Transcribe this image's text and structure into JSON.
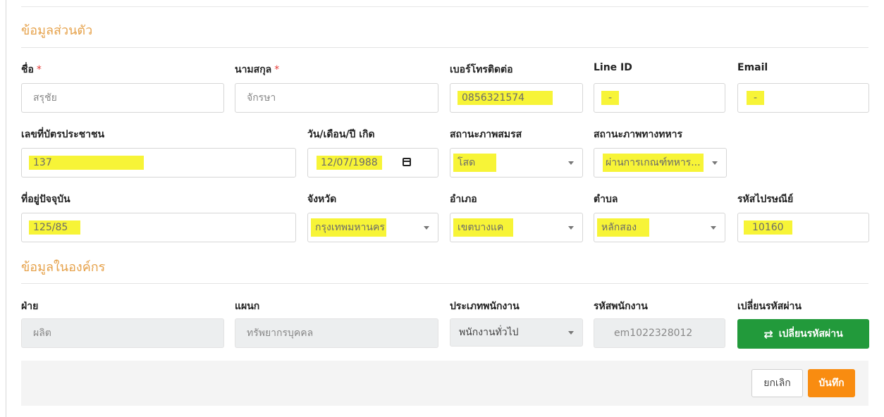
{
  "personal": {
    "title": "ข้อมูลส่วนตัว",
    "first_name": {
      "label": "ชื่อ",
      "required": "*",
      "placeholder": "สรุชัย"
    },
    "last_name": {
      "label": "นามสกุล",
      "required": "*",
      "placeholder": "จักรษา"
    },
    "phone": {
      "label": "เบอร์โทรติดต่อ",
      "value": "0856321574"
    },
    "line_id": {
      "label": "Line ID",
      "value": "-"
    },
    "email": {
      "label": "Email",
      "value": "-"
    },
    "id_card": {
      "label": "เลขที่บัตรประชาชน",
      "value": "137"
    },
    "birth_date": {
      "label": "วัน/เดือน/ปี เกิด",
      "value": "12/07/1988"
    },
    "marital_status": {
      "label": "สถานะภาพสมรส",
      "value": "โสด"
    },
    "military_status": {
      "label": "สถานะภาพทางทหาร",
      "value": "ผ่านการเกณฑ์ทหาร..."
    },
    "address": {
      "label": "ที่อยู่ปัจจุบัน",
      "value": "125/85"
    },
    "province": {
      "label": "จังหวัด",
      "value": "กรุงเทพมหานคร"
    },
    "district": {
      "label": "อำเภอ",
      "value": "เขตบางแค"
    },
    "subdistrict": {
      "label": "ตำบล",
      "value": "หลักสอง"
    },
    "postal_code": {
      "label": "รหัสไปรษณีย์",
      "value": "10160"
    }
  },
  "organization": {
    "title": "ข้อมูลในองค์กร",
    "department": {
      "label": "ฝ่าย",
      "value": "ผลิต"
    },
    "section": {
      "label": "แผนก",
      "value": "ทรัพยากรบุคคล"
    },
    "employee_type": {
      "label": "ประเภทพนักงาน",
      "value": "พนักงานทั่วไป"
    },
    "employee_id": {
      "label": "รหัสพนักงาน",
      "value": "em1022328012"
    },
    "change_password": {
      "label": "เปลี่ยนรหัสผ่าน",
      "button_label": "เปลี่ยนรหัสผ่าน"
    }
  },
  "footer": {
    "cancel_label": "ยกเลิก",
    "save_label": "บันทึก"
  },
  "icons": {
    "swap": "swap-arrows-icon",
    "calendar": "calendar-icon",
    "dropdown": "chevron-down-icon"
  },
  "colors": {
    "section_title": "#e6a24b",
    "highlight": "#f7f437",
    "green_button": "#229a3b",
    "save_button": "#f98c10",
    "required": "#e53935"
  }
}
